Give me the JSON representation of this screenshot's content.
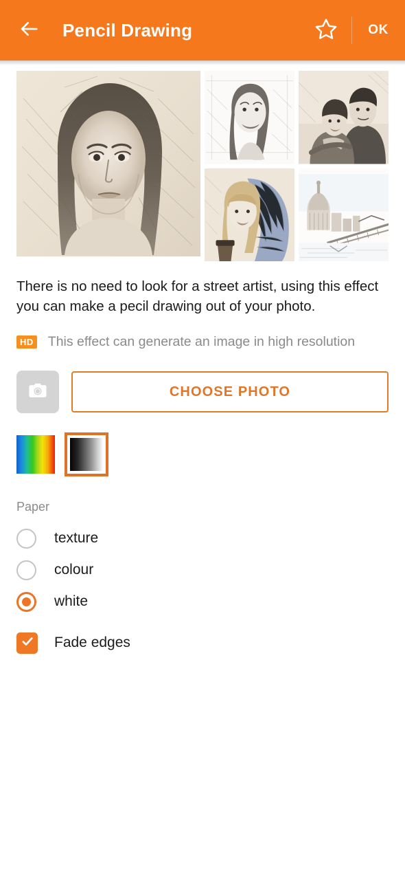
{
  "header": {
    "back_icon": "arrow-left-icon",
    "title": "Pencil Drawing",
    "favorite_icon": "star-outline-icon",
    "ok_label": "OK",
    "background_color": "#F5781C",
    "text_color": "#FFFFFF"
  },
  "gallery": {
    "hero": {
      "caption": "pencil-portrait-woman-dark-hair"
    },
    "thumbs": [
      {
        "caption": "pencil-portrait-smiling-girl"
      },
      {
        "caption": "pencil-portrait-couple-hugging"
      },
      {
        "caption": "pencil-portrait-blonde-girl-scarf-coffee"
      },
      {
        "caption": "pencil-sketch-city-cathedral-bridge"
      }
    ]
  },
  "description": "There is no need to look for a street artist, using this effect you can make a pecil drawing out of your photo.",
  "hd": {
    "badge": "HD",
    "badge_color": "#F5901E",
    "text": "This effect can generate an image in high resolution"
  },
  "actions": {
    "camera_icon": "camera-icon",
    "choose_photo_label": "CHOOSE PHOTO",
    "accent_color": "#E0762A"
  },
  "swatches": [
    {
      "name": "colour-gradient-swatch",
      "selected": false
    },
    {
      "name": "grayscale-gradient-swatch",
      "selected": true
    }
  ],
  "paper": {
    "label": "Paper",
    "options": [
      {
        "label": "texture",
        "selected": false
      },
      {
        "label": "colour",
        "selected": false
      },
      {
        "label": "white",
        "selected": true
      }
    ]
  },
  "fade_edges": {
    "label": "Fade edges",
    "checked": true,
    "color": "#F07723"
  }
}
